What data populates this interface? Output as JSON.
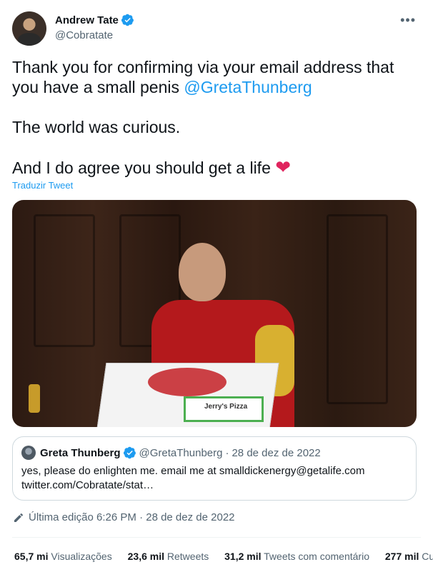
{
  "author": {
    "name": "Andrew Tate",
    "handle": "@Cobratate"
  },
  "tweet": {
    "line1": "Thank you for confirming via your email address that you have a small penis ",
    "mention": "@GretaThunberg",
    "line2": "The world was curious.",
    "line3": "And I do agree you should get a life ",
    "heart": "❤",
    "translate_label": "Traduzir Tweet"
  },
  "media": {
    "box_label": "Jerry's Pizza"
  },
  "quoted_tweet": {
    "name": "Greta Thunberg",
    "handle": "@GretaThunberg",
    "separator": "·",
    "date": "28 de dez de 2022",
    "text": "yes, please do enlighten me. email me at smalldickenergy@getalife.com twitter.com/Cobratate/stat…"
  },
  "edit_info": {
    "label": "Última edição 6:26 PM · 28 de dez de 2022"
  },
  "stats": {
    "views_count": "65,7 mi",
    "views_label": "Visualizações",
    "retweets_count": "23,6 mil",
    "retweets_label": "Retweets",
    "quotes_count": "31,2 mil",
    "quotes_label": "Tweets com comentário",
    "likes_count": "277 mil",
    "likes_label": "Cu"
  },
  "icons": {
    "verified": "verified-badge-icon",
    "more": "more-options-icon",
    "edit": "pencil-icon"
  },
  "colors": {
    "accent": "#1d9bf0",
    "secondary_text": "#536471",
    "heart": "#e0245e"
  }
}
